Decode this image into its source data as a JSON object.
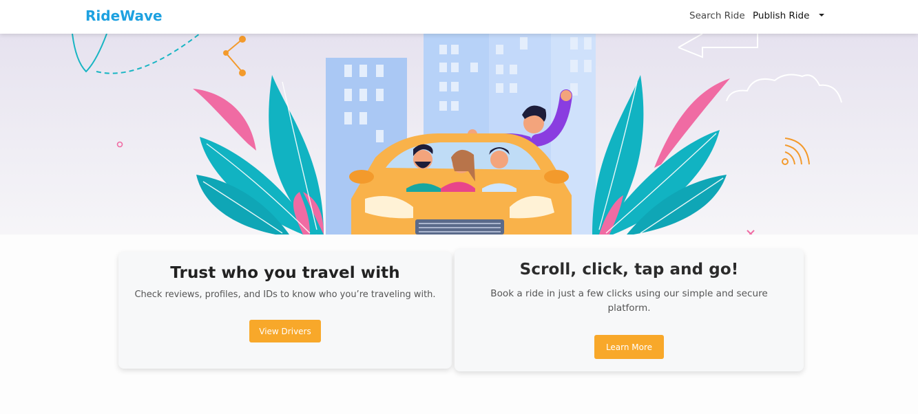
{
  "nav": {
    "brand": "RideWave",
    "links": [
      {
        "label": "Search Ride"
      },
      {
        "label": "Publish Ride"
      }
    ],
    "dropdown_icon": "caret-down-icon"
  },
  "hero": {
    "illustration": "friends-in-car-illustration"
  },
  "cards": [
    {
      "title": "Trust who you travel with",
      "text": "Check reviews, profiles, and IDs to know who you’re traveling with.",
      "button": "View Drivers"
    },
    {
      "title": "Scroll, click, tap and go!",
      "text": "Book a ride in just a few clicks using our simple and secure platform.",
      "button": "Learn More"
    }
  ],
  "colors": {
    "brand": "#1da1e0",
    "button": "#f8a82a",
    "leaf_teal": "#11b3c2",
    "leaf_pink": "#f06ba3",
    "car": "#f9b24a",
    "shirt_purple": "#8a3de0"
  }
}
